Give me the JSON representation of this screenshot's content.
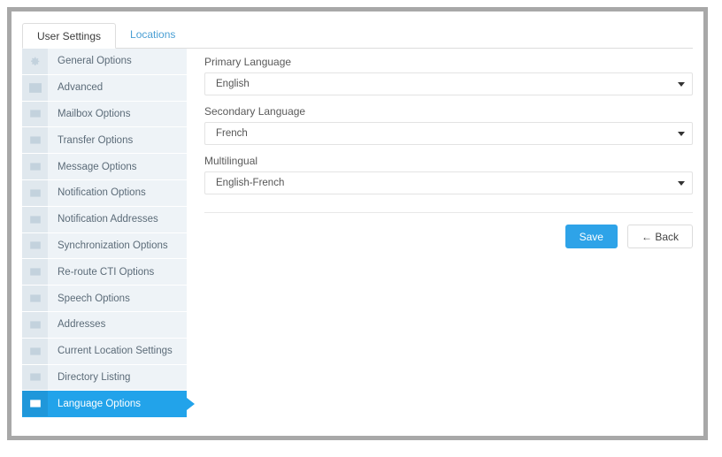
{
  "window": {
    "tabs": [
      {
        "label": "User Settings",
        "active": true
      },
      {
        "label": "Locations",
        "active": false
      }
    ]
  },
  "sidebar": {
    "items": [
      {
        "label": "General Options",
        "icon": "gear-icon",
        "active": false
      },
      {
        "label": "Advanced",
        "icon": "envelope-icon",
        "active": false
      },
      {
        "label": "Mailbox Options",
        "icon": "envelope-icon",
        "active": false
      },
      {
        "label": "Transfer Options",
        "icon": "envelope-icon",
        "active": false
      },
      {
        "label": "Message Options",
        "icon": "envelope-icon",
        "active": false
      },
      {
        "label": "Notification Options",
        "icon": "envelope-icon",
        "active": false
      },
      {
        "label": "Notification Addresses",
        "icon": "envelope-icon",
        "active": false
      },
      {
        "label": "Synchronization Options",
        "icon": "envelope-icon",
        "active": false
      },
      {
        "label": "Re-route CTI Options",
        "icon": "envelope-icon",
        "active": false
      },
      {
        "label": "Speech Options",
        "icon": "envelope-icon",
        "active": false
      },
      {
        "label": "Addresses",
        "icon": "envelope-icon",
        "active": false
      },
      {
        "label": "Current Location Settings",
        "icon": "envelope-icon",
        "active": false
      },
      {
        "label": "Directory Listing",
        "icon": "envelope-icon",
        "active": false
      },
      {
        "label": "Language Options",
        "icon": "envelope-icon",
        "active": true
      }
    ]
  },
  "form": {
    "fields": [
      {
        "label": "Primary Language",
        "value": "English"
      },
      {
        "label": "Secondary Language",
        "value": "French"
      },
      {
        "label": "Multilingual",
        "value": "English-French"
      }
    ]
  },
  "actions": {
    "save_label": "Save",
    "back_label": "← Back"
  },
  "colors": {
    "accent": "#22a3ea",
    "sidebar_row": "#eef3f7",
    "sidebar_icon_cell": "#e0e8ee",
    "frame_border": "#a8a8a8",
    "link": "#4a9fd4"
  }
}
